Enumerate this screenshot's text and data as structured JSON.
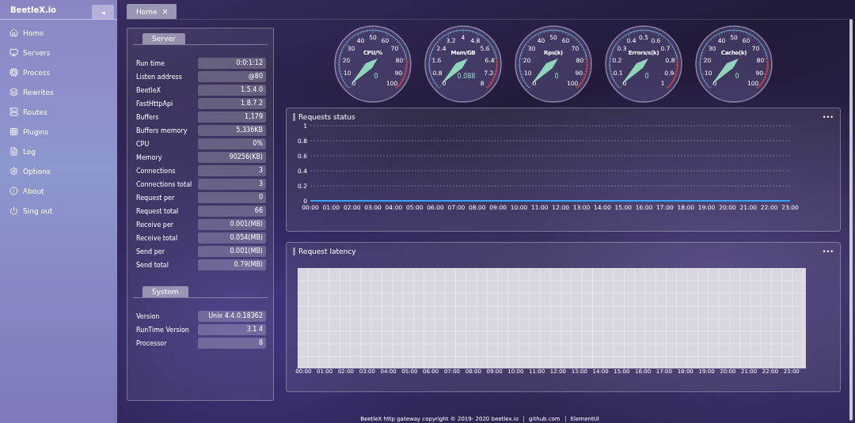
{
  "sidebar": {
    "brand": "BeetleX.io",
    "collapse_button": "◀",
    "items": [
      {
        "label": "Home",
        "selected": false
      },
      {
        "label": "Servers",
        "selected": false
      },
      {
        "label": "Process",
        "selected": false
      },
      {
        "label": "Rewrites",
        "selected": false
      },
      {
        "label": "Routes",
        "selected": false
      },
      {
        "label": "Plugins",
        "selected": false
      },
      {
        "label": "Log",
        "selected": false
      },
      {
        "label": "Options",
        "selected": false
      },
      {
        "label": "About",
        "selected": false
      },
      {
        "label": "Sing out",
        "selected": false
      }
    ]
  },
  "tabs": [
    {
      "label": "Home",
      "close": "×",
      "selected": true
    }
  ],
  "info_panel": {
    "sections": [
      {
        "title": "Server",
        "rows": [
          {
            "label": "Run time",
            "value": "0:0:1:12"
          },
          {
            "label": "Listen address",
            "value": "@80"
          },
          {
            "label": "BeetleX",
            "value": "1.5.4.0"
          },
          {
            "label": "FastHttpApi",
            "value": "1.8.7.2"
          },
          {
            "label": "Buffers",
            "value": "1,179"
          },
          {
            "label": "Buffers memory",
            "value": "5,336KB"
          },
          {
            "label": "CPU",
            "value": "0%"
          },
          {
            "label": "Memory",
            "value": "90256(KB)"
          },
          {
            "label": "Connections",
            "value": "3"
          },
          {
            "label": "Connections total",
            "value": "3"
          },
          {
            "label": "Request per",
            "value": "0"
          },
          {
            "label": "Request total",
            "value": "66"
          },
          {
            "label": "Receive per",
            "value": "0.001(MB)"
          },
          {
            "label": "Receive total",
            "value": "0.054(MB)"
          },
          {
            "label": "Send per",
            "value": "0.001(MB)"
          },
          {
            "label": "Send total",
            "value": "0.79(MB)"
          }
        ]
      },
      {
        "title": "System",
        "rows": [
          {
            "label": "Version",
            "value": "Unix 4.4.0.18362"
          },
          {
            "label": "RunTime Version",
            "value": "3.1.4"
          },
          {
            "label": "Processor",
            "value": "8"
          }
        ]
      }
    ]
  },
  "gauges": [
    {
      "title": "CPU/%",
      "reading": "0",
      "ticks": [
        "0",
        "10",
        "20",
        "30",
        "40",
        "50",
        "60",
        "70",
        "80",
        "90",
        "100"
      ]
    },
    {
      "title": "Mem/GB",
      "reading": "0.088",
      "ticks": [
        "0",
        "0.8",
        "1.6",
        "2.4",
        "3.2",
        "4",
        "4.8",
        "5.6",
        "6.4",
        "7.2",
        "8"
      ]
    },
    {
      "title": "Rps(k)",
      "reading": "0",
      "ticks": [
        "0",
        "10",
        "20",
        "30",
        "40",
        "50",
        "60",
        "70",
        "80",
        "90",
        "100"
      ]
    },
    {
      "title": "Errors/s(k)",
      "reading": "0",
      "ticks": [
        "0",
        "0.1",
        "0.2",
        "0.3",
        "0.4",
        "0.5",
        "0.6",
        "0.7",
        "0.8",
        "0.9",
        "1"
      ]
    },
    {
      "title": "Cache(k)",
      "reading": "0",
      "ticks": [
        "0",
        "10",
        "20",
        "30",
        "40",
        "50",
        "60",
        "70",
        "80",
        "90",
        "100"
      ]
    }
  ],
  "requests_status": {
    "title": "Requests status",
    "menu": "•••",
    "chart_data": {
      "type": "line",
      "categories": [
        "00:00",
        "01:00",
        "02:00",
        "03:00",
        "04:00",
        "05:00",
        "06:00",
        "07:00",
        "08:00",
        "09:00",
        "10:00",
        "11:00",
        "12:00",
        "13:00",
        "14:00",
        "15:00",
        "16:00",
        "17:00",
        "18:00",
        "19:00",
        "20:00",
        "21:00",
        "22:00",
        "23:00"
      ],
      "grid": true,
      "series": [
        {
          "color": "#409eff",
          "values": [
            0,
            0,
            0,
            0,
            0,
            0,
            0,
            0,
            0,
            0,
            0,
            0,
            0,
            0,
            0,
            0,
            0,
            0,
            0,
            0,
            0,
            0,
            0,
            0
          ]
        }
      ],
      "ylim": [
        0,
        1
      ],
      "yticks": [
        0,
        0.2,
        0.4,
        0.6,
        0.8,
        1
      ]
    }
  },
  "request_latency": {
    "title": "Request latency",
    "menu": "•••",
    "x_labels": [
      "00:00",
      "01:00",
      "02:00",
      "03:00",
      "04:00",
      "05:00",
      "06:00",
      "07:00",
      "08:00",
      "09:00",
      "10:00",
      "11:00",
      "12:00",
      "13:00",
      "14:00",
      "15:00",
      "16:00",
      "17:00",
      "18:00",
      "19:00",
      "20:00",
      "21:00",
      "22:00",
      "23:00"
    ]
  },
  "footer": {
    "copyright": "BeetleX http gateway copyright © 2019- 2020 beetlex.io",
    "links": [
      "github.com",
      "ElementUI"
    ]
  }
}
